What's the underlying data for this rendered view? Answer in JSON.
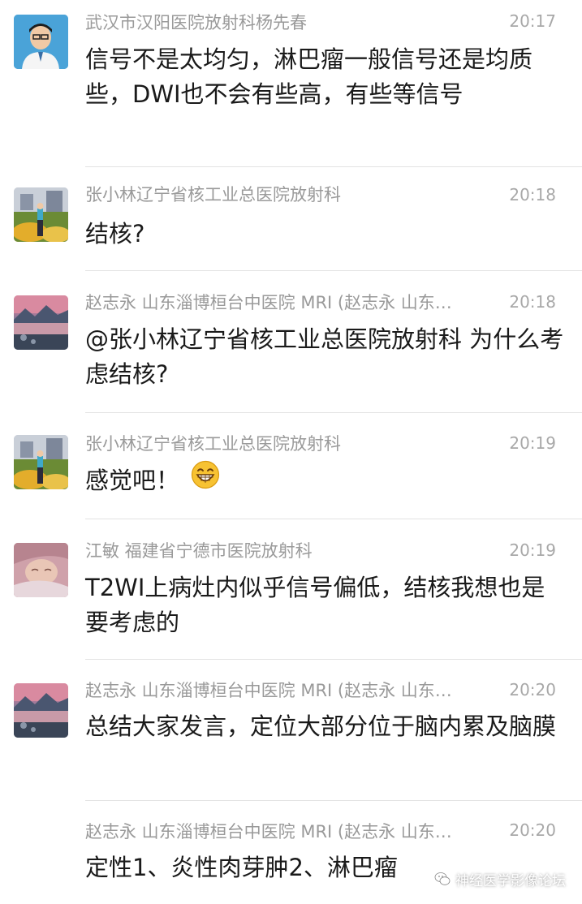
{
  "messages": [
    {
      "sender": "武汉市汉阳医院放射科杨先春",
      "time": "20:17",
      "text": "信号不是太均匀，淋巴瘤一般信号还是均质些，DWI也不会有些高，有些等信号",
      "avatar_icon": "person-portrait-avatar"
    },
    {
      "sender": "张小林辽宁省核工业总医院放射科",
      "time": "20:18",
      "text": "结核?",
      "avatar_icon": "landscape-avatar"
    },
    {
      "sender": "赵志永 山东淄博桓台中医院 MRI (赵志永 山东…",
      "time": "20:18",
      "text": "@张小林辽宁省核工业总医院放射科 为什么考虑结核?",
      "avatar_icon": "lake-avatar"
    },
    {
      "sender": "张小林辽宁省核工业总医院放射科",
      "time": "20:19",
      "text": "感觉吧！",
      "emoji": "grin-emoji",
      "avatar_icon": "landscape-avatar"
    },
    {
      "sender": "江敏 福建省宁德市医院放射科",
      "time": "20:19",
      "text": "T2WI上病灶内似乎信号偏低，结核我想也是要考虑的",
      "avatar_icon": "baby-avatar"
    },
    {
      "sender": "赵志永 山东淄博桓台中医院 MRI (赵志永 山东…",
      "time": "20:20",
      "text": "总结大家发言，定位大部分位于脑内累及脑膜",
      "avatar_icon": "lake-avatar"
    },
    {
      "sender": "赵志永 山东淄博桓台中医院 MRI (赵志永 山东…",
      "time": "20:20",
      "text": "定性1、炎性肉芽肿2、淋巴瘤"
    }
  ],
  "watermark": {
    "label": "神经医学影像论坛",
    "icon": "wechat-icon"
  },
  "colors": {
    "sender_text": "#9a9a9a",
    "time_text": "#a8a8a8",
    "message_text": "#1a1a1a",
    "divider": "#e3e3e3"
  }
}
